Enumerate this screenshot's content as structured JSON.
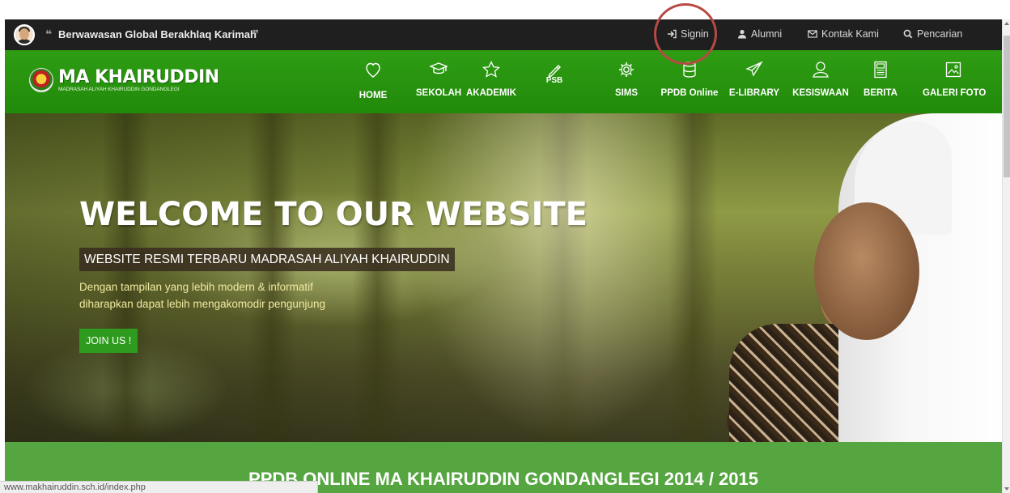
{
  "topbar": {
    "quote_left": "66",
    "tagline": "Berwawasan Global Berakhlaq Karimah",
    "quote_right": "99",
    "links": {
      "signin": "Signin",
      "alumni": "Alumni",
      "kontak": "Kontak Kami",
      "cari": "Pencarian"
    }
  },
  "logo": {
    "title": "MA KHAIRUDDIN",
    "subtitle": "MADRASAH ALIYAH KHAIRUDDIN GONDANGLEGI"
  },
  "nav": {
    "home": "HOME",
    "sekolah": "SEKOLAH",
    "akademik": "AKADEMIK",
    "psb": "PSB",
    "sims": "SIMS",
    "ppdb": "PPDB Online",
    "elibrary": "E-LIBRARY",
    "kesiswaan": "KESISWAAN",
    "berita": "BERITA",
    "galeri": "GALERI FOTO"
  },
  "hero": {
    "title": "WELCOME TO OUR WEBSITE",
    "subtitle": "WEBSITE RESMI TERBARU MADRASAH ALIYAH KHAIRUDDIN",
    "desc_line1": "Dengan tampilan yang lebih modern & informatif",
    "desc_line2": "diharapkan dapat lebih mengakomodir pengunjung",
    "button": "JOIN US !"
  },
  "ppdb": {
    "title": "PPDB ONLINE MA KHAIRUDDIN GONDANGLEGI 2014 / 2015"
  },
  "status": {
    "url": "www.makhairuddin.sch.id/index.php"
  },
  "colors": {
    "topbar": "#1f1f1f",
    "nav_green": "#2f9d14",
    "accent_button": "#2e9a1e",
    "ppdb_band": "#55a540",
    "annotation_circle": "#b74a44"
  }
}
